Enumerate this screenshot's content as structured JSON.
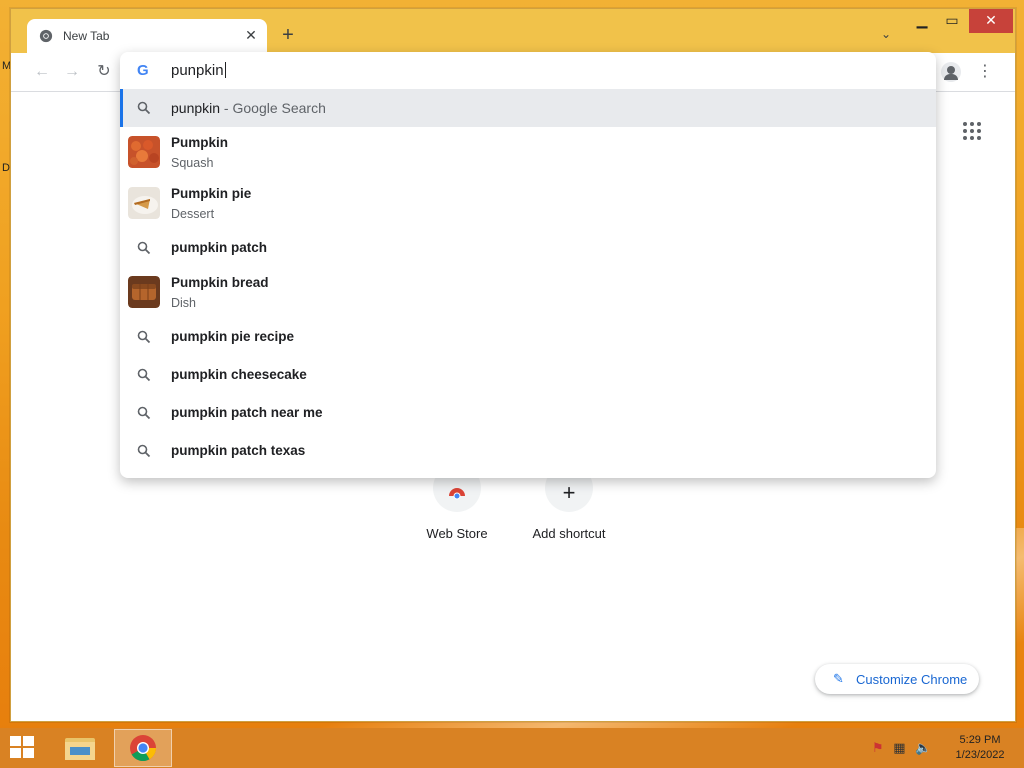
{
  "desktop": {
    "edge_letters": [
      "M",
      "D"
    ]
  },
  "browser": {
    "tab": {
      "title": "New Tab"
    },
    "omnibox": {
      "query": "punpkin",
      "suggestions": [
        {
          "kind": "search",
          "text": "punpkin",
          "suffix": " - Google Search",
          "selected": true
        },
        {
          "kind": "entity",
          "title": "Pumpkin",
          "subtitle": "Squash"
        },
        {
          "kind": "entity",
          "title": "Pumpkin pie",
          "subtitle": "Dessert"
        },
        {
          "kind": "search",
          "text": "pumpkin patch"
        },
        {
          "kind": "entity",
          "title": "Pumpkin bread",
          "subtitle": "Dish"
        },
        {
          "kind": "search",
          "text": "pumpkin pie recipe"
        },
        {
          "kind": "search",
          "text": "pumpkin cheesecake"
        },
        {
          "kind": "search",
          "text": "pumpkin patch near me"
        },
        {
          "kind": "search",
          "text": "pumpkin patch texas"
        }
      ]
    },
    "newtab": {
      "shortcuts": [
        {
          "label": "Web Store"
        },
        {
          "label": "Add shortcut"
        }
      ],
      "customize_label": "Customize Chrome"
    }
  },
  "taskbar": {
    "time": "5:29 PM",
    "date": "1/23/2022"
  },
  "colors": {
    "accent": "#1a73e8",
    "window_frame": "#f1c24a",
    "close_button": "#c7423a"
  }
}
